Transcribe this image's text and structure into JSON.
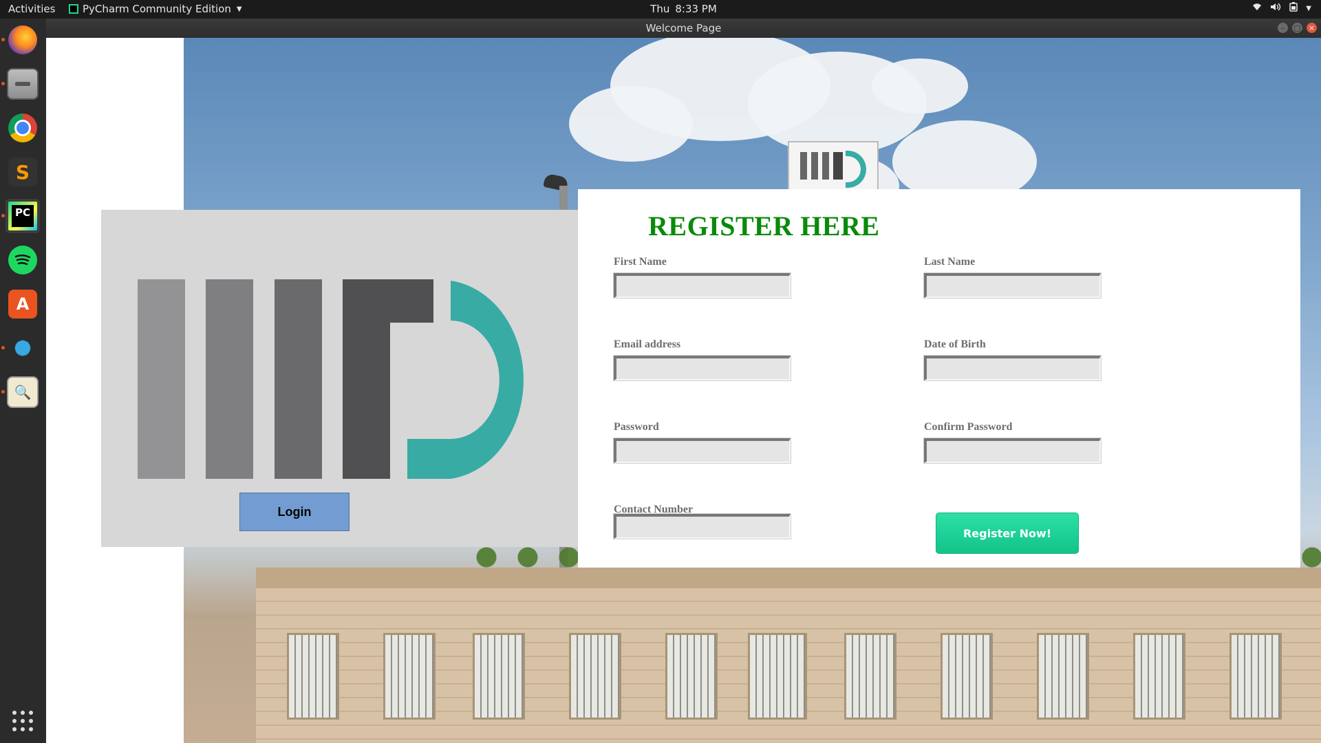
{
  "topbar": {
    "activities": "Activities",
    "app_name": "PyCharm Community Edition",
    "day": "Thu",
    "time": "8:33 PM"
  },
  "window": {
    "title": "Welcome Page"
  },
  "dock": {
    "items": [
      {
        "name": "firefox-icon"
      },
      {
        "name": "files-icon"
      },
      {
        "name": "chrome-icon"
      },
      {
        "name": "sublime-text-icon"
      },
      {
        "name": "pycharm-icon"
      },
      {
        "name": "spotify-icon"
      },
      {
        "name": "software-center-icon"
      },
      {
        "name": "paint-splash-icon"
      },
      {
        "name": "image-viewer-icon"
      }
    ],
    "apps_grid_icon": "show-applications-icon"
  },
  "login": {
    "button_label": "Login"
  },
  "register": {
    "title": "REGISTER HERE",
    "first_name_label": "First Name",
    "last_name_label": "Last Name",
    "email_label": "Email address",
    "dob_label": "Date of Birth",
    "password_label": "Password",
    "confirm_password_label": "Confirm Password",
    "contact_label": "Contact Number",
    "first_name_value": "",
    "last_name_value": "",
    "email_value": "",
    "dob_value": "",
    "password_value": "",
    "confirm_password_value": "",
    "contact_value": "",
    "submit_label": "Register Now!"
  },
  "colors": {
    "title_green": "#0a8a0a",
    "login_blue": "#739dd2",
    "register_green": "#1fd39a",
    "logo_teal": "#38aba5"
  }
}
